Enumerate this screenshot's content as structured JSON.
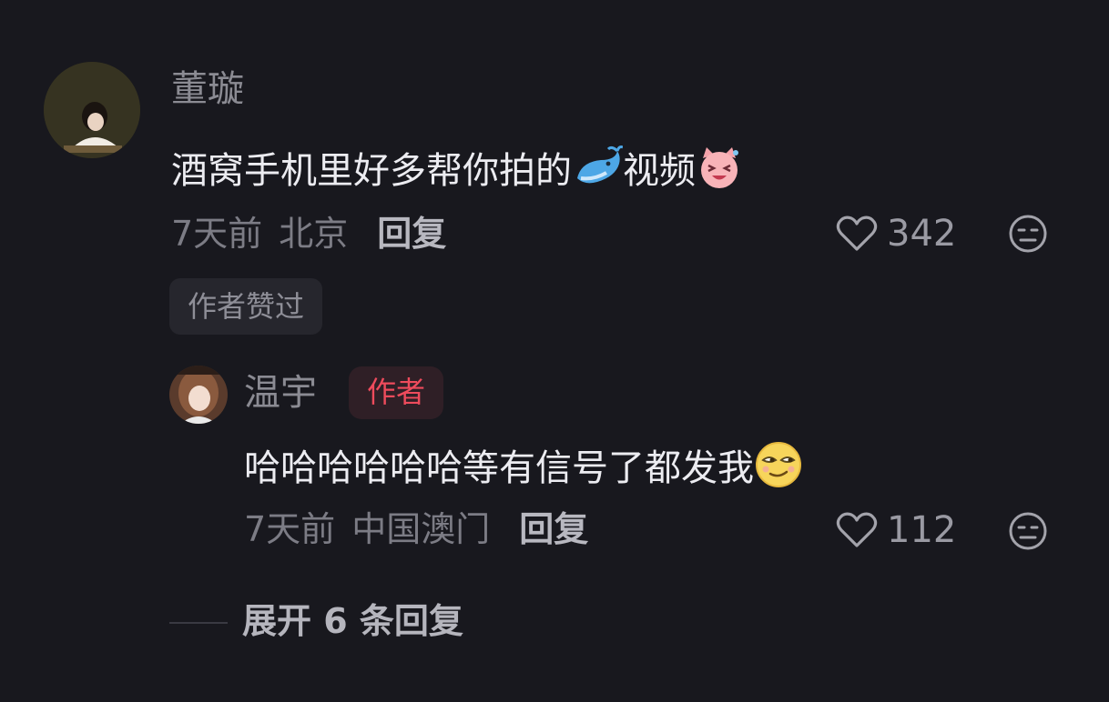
{
  "comment": {
    "username": "董璇",
    "text_before": "酒窝手机里好多帮你拍的",
    "emoji_1": "whale-icon",
    "text_after": "视频",
    "emoji_2": "laughing-face-sticker-icon",
    "time": "7天前",
    "location": "北京",
    "reply_label": "回复",
    "like_count": "342",
    "author_liked_badge": "作者赞过"
  },
  "reply": {
    "username": "温宇",
    "author_tag": "作者",
    "text": "哈哈哈哈哈哈等有信号了都发我",
    "emoji": "sly-smile-face-icon",
    "time": "7天前",
    "location": "中国澳门",
    "reply_label": "回复",
    "like_count": "112"
  },
  "expand_replies_label": "展开 6 条回复",
  "colors": {
    "background": "#18181e",
    "author_tag_text": "#ee4b5c",
    "author_tag_bg": "#2f1f26"
  }
}
